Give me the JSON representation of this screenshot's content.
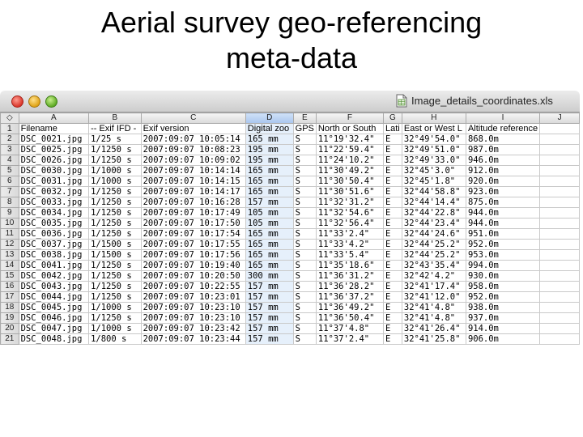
{
  "slide": {
    "title_line1": "Aerial survey geo-referencing",
    "title_line2": "meta-data"
  },
  "window": {
    "title": "Image_details_coordinates.xls",
    "file_icon": "spreadsheet-doc-icon",
    "controls": [
      "close",
      "minimize",
      "zoom"
    ]
  },
  "sheet": {
    "corner_glyph": "◇",
    "selected_column": "D",
    "columns": [
      "A",
      "B",
      "C",
      "D",
      "E",
      "F",
      "G",
      "H",
      "I",
      "J"
    ],
    "rows": [
      {
        "n": "1",
        "cells": [
          "Filename",
          "-- Exif IFD -",
          "Exif version",
          "Digital zoo",
          "GPS",
          "North or South",
          "Lati",
          "East or West L",
          "Altitude reference",
          ""
        ]
      },
      {
        "n": "2",
        "cells": [
          "DSC_0021.jpg",
          "1/25 s",
          "2007:09:07 10:05:14",
          "165 mm",
          "S",
          "11°19'32.4\"",
          "E",
          "32°49'54.0\"",
          "868.0m",
          ""
        ]
      },
      {
        "n": "3",
        "cells": [
          "DSC_0025.jpg",
          "1/1250 s",
          "2007:09:07 10:08:23",
          "195 mm",
          "S",
          "11°22'59.4\"",
          "E",
          "32°49'51.0\"",
          "987.0m",
          ""
        ]
      },
      {
        "n": "4",
        "cells": [
          "DSC_0026.jpg",
          "1/1250 s",
          "2007:09:07 10:09:02",
          "195 mm",
          "S",
          "11°24'10.2\"",
          "E",
          "32°49'33.0\"",
          "946.0m",
          ""
        ]
      },
      {
        "n": "5",
        "cells": [
          "DSC_0030.jpg",
          "1/1000 s",
          "2007:09:07 10:14:14",
          "165 mm",
          "S",
          "11°30'49.2\"",
          "E",
          "32°45'3.0\"",
          "912.0m",
          ""
        ]
      },
      {
        "n": "6",
        "cells": [
          "DSC_0031.jpg",
          "1/1000 s",
          "2007:09:07 10:14:15",
          "165 mm",
          "S",
          "11°30'50.4\"",
          "E",
          "32°45'1.8\"",
          "920.0m",
          ""
        ]
      },
      {
        "n": "7",
        "cells": [
          "DSC_0032.jpg",
          "1/1250 s",
          "2007:09:07 10:14:17",
          "165 mm",
          "S",
          "11°30'51.6\"",
          "E",
          "32°44'58.8\"",
          "923.0m",
          ""
        ]
      },
      {
        "n": "8",
        "cells": [
          "DSC_0033.jpg",
          "1/1250 s",
          "2007:09:07 10:16:28",
          "157 mm",
          "S",
          "11°32'31.2\"",
          "E",
          "32°44'14.4\"",
          "875.0m",
          ""
        ]
      },
      {
        "n": "9",
        "cells": [
          "DSC_0034.jpg",
          "1/1250 s",
          "2007:09:07 10:17:49",
          "105 mm",
          "S",
          "11°32'54.6\"",
          "E",
          "32°44'22.8\"",
          "944.0m",
          ""
        ]
      },
      {
        "n": "10",
        "cells": [
          "DSC_0035.jpg",
          "1/1250 s",
          "2007:09:07 10:17:50",
          "105 mm",
          "S",
          "11°32'56.4\"",
          "E",
          "32°44'23.4\"",
          "944.0m",
          ""
        ]
      },
      {
        "n": "11",
        "cells": [
          "DSC_0036.jpg",
          "1/1250 s",
          "2007:09:07 10:17:54",
          "165 mm",
          "S",
          "11°33'2.4\"",
          "E",
          "32°44'24.6\"",
          "951.0m",
          ""
        ]
      },
      {
        "n": "12",
        "cells": [
          "DSC_0037.jpg",
          "1/1500 s",
          "2007:09:07 10:17:55",
          "165 mm",
          "S",
          "11°33'4.2\"",
          "E",
          "32°44'25.2\"",
          "952.0m",
          ""
        ]
      },
      {
        "n": "13",
        "cells": [
          "DSC_0038.jpg",
          "1/1500 s",
          "2007:09:07 10:17:56",
          "165 mm",
          "S",
          "11°33'5.4\"",
          "E",
          "32°44'25.2\"",
          "953.0m",
          ""
        ]
      },
      {
        "n": "14",
        "cells": [
          "DSC_0041.jpg",
          "1/1250 s",
          "2007:09:07 10:19:40",
          "165 mm",
          "S",
          "11°35'18.6\"",
          "E",
          "32°43'35.4\"",
          "994.0m",
          ""
        ]
      },
      {
        "n": "15",
        "cells": [
          "DSC_0042.jpg",
          "1/1250 s",
          "2007:09:07 10:20:50",
          "300 mm",
          "S",
          "11°36'31.2\"",
          "E",
          "32°42'4.2\"",
          "930.0m",
          ""
        ]
      },
      {
        "n": "16",
        "cells": [
          "DSC_0043.jpg",
          "1/1250 s",
          "2007:09:07 10:22:55",
          "157 mm",
          "S",
          "11°36'28.2\"",
          "E",
          "32°41'17.4\"",
          "958.0m",
          ""
        ]
      },
      {
        "n": "17",
        "cells": [
          "DSC_0044.jpg",
          "1/1250 s",
          "2007:09:07 10:23:01",
          "157 mm",
          "S",
          "11°36'37.2\"",
          "E",
          "32°41'12.0\"",
          "952.0m",
          ""
        ]
      },
      {
        "n": "18",
        "cells": [
          "DSC_0045.jpg",
          "1/1000 s",
          "2007:09:07 10:23:10",
          "157 mm",
          "S",
          "11°36'49.2\"",
          "E",
          "32°41'4.8\"",
          "938.0m",
          ""
        ]
      },
      {
        "n": "19",
        "cells": [
          "DSC_0046.jpg",
          "1/1250 s",
          "2007:09:07 10:23:10",
          "157 mm",
          "S",
          "11°36'50.4\"",
          "E",
          "32°41'4.8\"",
          "937.0m",
          ""
        ]
      },
      {
        "n": "20",
        "cells": [
          "DSC_0047.jpg",
          "1/1000 s",
          "2007:09:07 10:23:42",
          "157 mm",
          "S",
          "11°37'4.8\"",
          "E",
          "32°41'26.4\"",
          "914.0m",
          ""
        ]
      },
      {
        "n": "21",
        "cells": [
          "DSC_0048.jpg",
          "1/800 s",
          "2007:09:07 10:23:44",
          "157 mm",
          "S",
          "11°37'2.4\"",
          "E",
          "32°41'25.8\"",
          "906.0m",
          ""
        ]
      }
    ]
  }
}
